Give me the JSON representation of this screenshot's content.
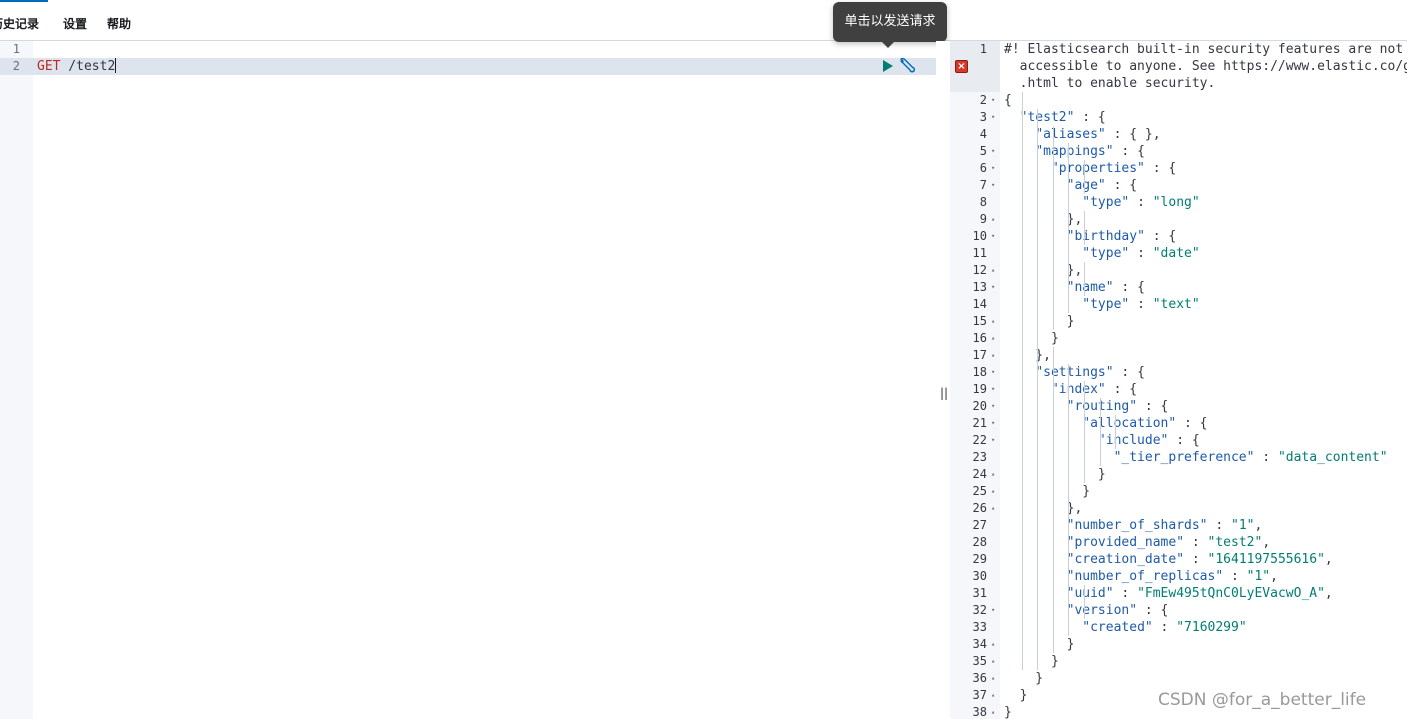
{
  "menu": {
    "history": "历史记录",
    "settings": "设置",
    "help": "帮助"
  },
  "tooltip": {
    "send": "单击以发送请求"
  },
  "editor": {
    "lines": [
      {
        "num": "1",
        "method": "",
        "path": ""
      },
      {
        "num": "2",
        "method": "GET",
        "path": " /test2"
      }
    ]
  },
  "icons": {
    "run": "play-icon",
    "wrench": "wrench-icon",
    "error": "error-icon",
    "resize": "resize-grip-icon"
  },
  "resizer": {
    "grip": "||"
  },
  "output": {
    "lines": [
      {
        "num": "1",
        "fold": "",
        "segs": [
          [
            "comment",
            "#! Elasticsearch built-in security features are not enabled. Without authentication, your cluster could be"
          ]
        ]
      },
      {
        "num": "",
        "fold": "",
        "segs": [
          [
            "comment",
            "  accessible to anyone. See https://www.elastic.co/guide/en/elasticsearch/reference/7.16/security-minimal-setup"
          ]
        ]
      },
      {
        "num": "",
        "fold": "",
        "segs": [
          [
            "comment",
            "  .html to enable security."
          ]
        ]
      },
      {
        "num": "2",
        "fold": "▾",
        "segs": [
          [
            "p",
            "{"
          ]
        ]
      },
      {
        "num": "3",
        "fold": "▾",
        "segs": [
          [
            "p",
            "  "
          ],
          [
            "key",
            "\"test2\""
          ],
          [
            "p",
            " : {"
          ]
        ]
      },
      {
        "num": "4",
        "fold": "",
        "segs": [
          [
            "p",
            "    "
          ],
          [
            "key",
            "\"aliases\""
          ],
          [
            "p",
            " : { },"
          ]
        ]
      },
      {
        "num": "5",
        "fold": "▾",
        "segs": [
          [
            "p",
            "    "
          ],
          [
            "key",
            "\"mappings\""
          ],
          [
            "p",
            " : {"
          ]
        ]
      },
      {
        "num": "6",
        "fold": "▾",
        "segs": [
          [
            "p",
            "      "
          ],
          [
            "key",
            "\"properties\""
          ],
          [
            "p",
            " : {"
          ]
        ]
      },
      {
        "num": "7",
        "fold": "▾",
        "segs": [
          [
            "p",
            "        "
          ],
          [
            "key",
            "\"age\""
          ],
          [
            "p",
            " : {"
          ]
        ]
      },
      {
        "num": "8",
        "fold": "",
        "segs": [
          [
            "p",
            "          "
          ],
          [
            "key",
            "\"type\""
          ],
          [
            "p",
            " : "
          ],
          [
            "str",
            "\"long\""
          ]
        ]
      },
      {
        "num": "9",
        "fold": "▴",
        "segs": [
          [
            "p",
            "        },"
          ]
        ]
      },
      {
        "num": "10",
        "fold": "▾",
        "segs": [
          [
            "p",
            "        "
          ],
          [
            "key",
            "\"birthday\""
          ],
          [
            "p",
            " : {"
          ]
        ]
      },
      {
        "num": "11",
        "fold": "",
        "segs": [
          [
            "p",
            "          "
          ],
          [
            "key",
            "\"type\""
          ],
          [
            "p",
            " : "
          ],
          [
            "str",
            "\"date\""
          ]
        ]
      },
      {
        "num": "12",
        "fold": "▴",
        "segs": [
          [
            "p",
            "        },"
          ]
        ]
      },
      {
        "num": "13",
        "fold": "▾",
        "segs": [
          [
            "p",
            "        "
          ],
          [
            "key",
            "\"name\""
          ],
          [
            "p",
            " : {"
          ]
        ]
      },
      {
        "num": "14",
        "fold": "",
        "segs": [
          [
            "p",
            "          "
          ],
          [
            "key",
            "\"type\""
          ],
          [
            "p",
            " : "
          ],
          [
            "str",
            "\"text\""
          ]
        ]
      },
      {
        "num": "15",
        "fold": "▴",
        "segs": [
          [
            "p",
            "        }"
          ]
        ]
      },
      {
        "num": "16",
        "fold": "▴",
        "segs": [
          [
            "p",
            "      }"
          ]
        ]
      },
      {
        "num": "17",
        "fold": "▴",
        "segs": [
          [
            "p",
            "    },"
          ]
        ]
      },
      {
        "num": "18",
        "fold": "▾",
        "segs": [
          [
            "p",
            "    "
          ],
          [
            "key",
            "\"settings\""
          ],
          [
            "p",
            " : {"
          ]
        ]
      },
      {
        "num": "19",
        "fold": "▾",
        "segs": [
          [
            "p",
            "      "
          ],
          [
            "key",
            "\"index\""
          ],
          [
            "p",
            " : {"
          ]
        ]
      },
      {
        "num": "20",
        "fold": "▾",
        "segs": [
          [
            "p",
            "        "
          ],
          [
            "key",
            "\"routing\""
          ],
          [
            "p",
            " : {"
          ]
        ]
      },
      {
        "num": "21",
        "fold": "▾",
        "segs": [
          [
            "p",
            "          "
          ],
          [
            "key",
            "\"allocation\""
          ],
          [
            "p",
            " : {"
          ]
        ]
      },
      {
        "num": "22",
        "fold": "▾",
        "segs": [
          [
            "p",
            "            "
          ],
          [
            "key",
            "\"include\""
          ],
          [
            "p",
            " : {"
          ]
        ]
      },
      {
        "num": "23",
        "fold": "",
        "segs": [
          [
            "p",
            "              "
          ],
          [
            "key",
            "\"_tier_preference\""
          ],
          [
            "p",
            " : "
          ],
          [
            "str",
            "\"data_content\""
          ]
        ]
      },
      {
        "num": "24",
        "fold": "▴",
        "segs": [
          [
            "p",
            "            }"
          ]
        ]
      },
      {
        "num": "25",
        "fold": "▴",
        "segs": [
          [
            "p",
            "          }"
          ]
        ]
      },
      {
        "num": "26",
        "fold": "▴",
        "segs": [
          [
            "p",
            "        },"
          ]
        ]
      },
      {
        "num": "27",
        "fold": "",
        "segs": [
          [
            "p",
            "        "
          ],
          [
            "key",
            "\"number_of_shards\""
          ],
          [
            "p",
            " : "
          ],
          [
            "str",
            "\"1\""
          ],
          [
            "p",
            ","
          ]
        ]
      },
      {
        "num": "28",
        "fold": "",
        "segs": [
          [
            "p",
            "        "
          ],
          [
            "key",
            "\"provided_name\""
          ],
          [
            "p",
            " : "
          ],
          [
            "str",
            "\"test2\""
          ],
          [
            "p",
            ","
          ]
        ]
      },
      {
        "num": "29",
        "fold": "",
        "segs": [
          [
            "p",
            "        "
          ],
          [
            "key",
            "\"creation_date\""
          ],
          [
            "p",
            " : "
          ],
          [
            "str",
            "\"1641197555616\""
          ],
          [
            "p",
            ","
          ]
        ]
      },
      {
        "num": "30",
        "fold": "",
        "segs": [
          [
            "p",
            "        "
          ],
          [
            "key",
            "\"number_of_replicas\""
          ],
          [
            "p",
            " : "
          ],
          [
            "str",
            "\"1\""
          ],
          [
            "p",
            ","
          ]
        ]
      },
      {
        "num": "31",
        "fold": "",
        "segs": [
          [
            "p",
            "        "
          ],
          [
            "key",
            "\"uuid\""
          ],
          [
            "p",
            " : "
          ],
          [
            "str",
            "\"FmEw495tQnC0LyEVacwO_A\""
          ],
          [
            "p",
            ","
          ]
        ]
      },
      {
        "num": "32",
        "fold": "▾",
        "segs": [
          [
            "p",
            "        "
          ],
          [
            "key",
            "\"version\""
          ],
          [
            "p",
            " : {"
          ]
        ]
      },
      {
        "num": "33",
        "fold": "",
        "segs": [
          [
            "p",
            "          "
          ],
          [
            "key",
            "\"created\""
          ],
          [
            "p",
            " : "
          ],
          [
            "str",
            "\"7160299\""
          ]
        ]
      },
      {
        "num": "34",
        "fold": "▴",
        "segs": [
          [
            "p",
            "        }"
          ]
        ]
      },
      {
        "num": "35",
        "fold": "▴",
        "segs": [
          [
            "p",
            "      }"
          ]
        ]
      },
      {
        "num": "36",
        "fold": "▴",
        "segs": [
          [
            "p",
            "    }"
          ]
        ]
      },
      {
        "num": "37",
        "fold": "▴",
        "segs": [
          [
            "p",
            "  }"
          ]
        ]
      },
      {
        "num": "38",
        "fold": "▴",
        "segs": [
          [
            "p",
            "}"
          ]
        ]
      }
    ]
  },
  "watermark": "CSDN @for_a_better_life"
}
